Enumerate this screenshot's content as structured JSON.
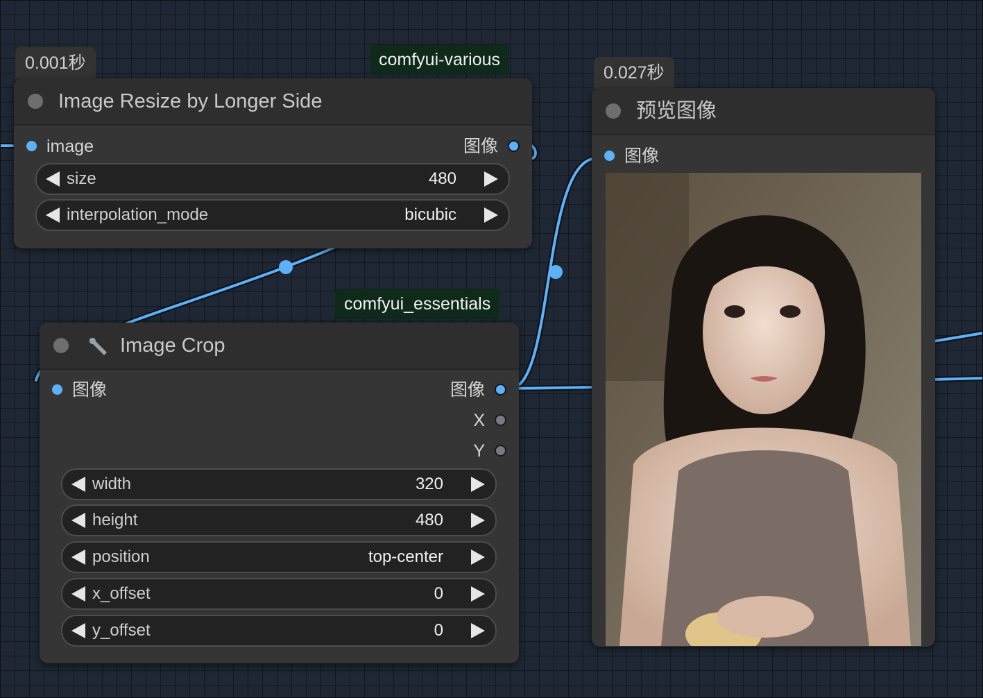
{
  "nodes": {
    "resize": {
      "timing": "0.001秒",
      "pack": "comfyui-various",
      "title": "Image Resize by Longer Side",
      "input_label": "image",
      "output_label": "图像",
      "widgets": [
        {
          "label": "size",
          "value": "480"
        },
        {
          "label": "interpolation_mode",
          "value": "bicubic"
        }
      ]
    },
    "crop": {
      "pack": "comfyui_essentials",
      "title": "Image Crop",
      "input_label": "图像",
      "outputs": [
        "图像",
        "X",
        "Y"
      ],
      "widgets": [
        {
          "label": "width",
          "value": "320"
        },
        {
          "label": "height",
          "value": "480"
        },
        {
          "label": "position",
          "value": "top-center"
        },
        {
          "label": "x_offset",
          "value": "0"
        },
        {
          "label": "y_offset",
          "value": "0"
        }
      ]
    },
    "preview": {
      "timing": "0.027秒",
      "title": "预览图像",
      "input_label": "图像"
    }
  },
  "colors": {
    "canvas": "#1e2733",
    "node_body": "#353535",
    "node_header": "#2e2e2e",
    "image_link": "#5db1f6",
    "pack_badge": "#0f2a1a"
  },
  "icons": [
    "wrench-icon",
    "collapse-dot-icon",
    "arrow-left-icon",
    "arrow-right-icon"
  ]
}
